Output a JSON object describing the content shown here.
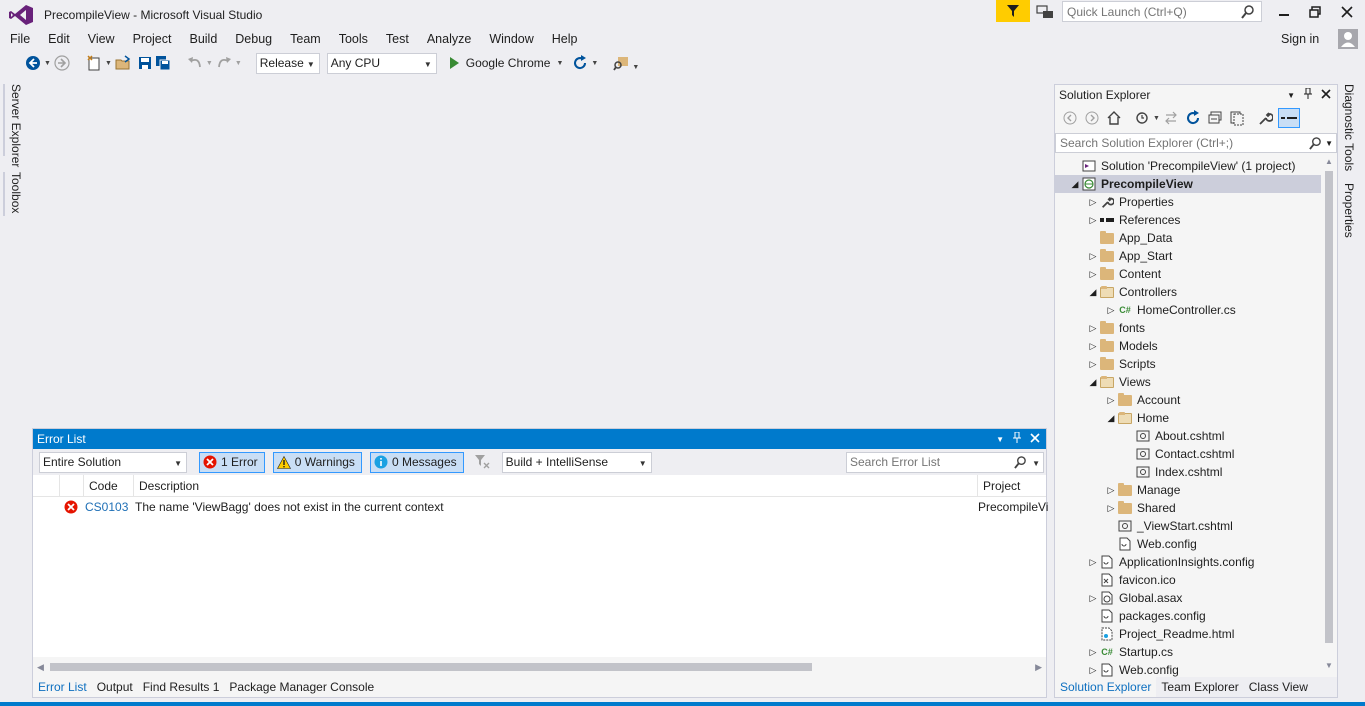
{
  "window": {
    "title": "PrecompileView - Microsoft Visual Studio",
    "quick_launch_placeholder": "Quick Launch (Ctrl+Q)",
    "sign_in": "Sign in"
  },
  "menu": [
    "File",
    "Edit",
    "View",
    "Project",
    "Build",
    "Debug",
    "Team",
    "Tools",
    "Test",
    "Analyze",
    "Window",
    "Help"
  ],
  "toolbar": {
    "configuration": "Release",
    "platform": "Any CPU",
    "run_target": "Google Chrome"
  },
  "left_tabs": [
    "Server Explorer",
    "Toolbox"
  ],
  "right_tabs": [
    "Diagnostic Tools",
    "Properties"
  ],
  "error_list": {
    "title": "Error List",
    "scope": "Entire Solution",
    "errors_label": "1 Error",
    "warnings_label": "0 Warnings",
    "messages_label": "0 Messages",
    "build_filter": "Build + IntelliSense",
    "search_placeholder": "Search Error List",
    "columns": {
      "code": "Code",
      "description": "Description",
      "project": "Project"
    },
    "rows": [
      {
        "code": "CS0103",
        "description": "The name 'ViewBagg' does not exist in the current context",
        "project": "PrecompileVi"
      }
    ]
  },
  "bottom_tabs": [
    "Error List",
    "Output",
    "Find Results 1",
    "Package Manager Console"
  ],
  "solution_explorer": {
    "title": "Solution Explorer",
    "search_placeholder": "Search Solution Explorer (Ctrl+;)",
    "tree": [
      {
        "label": "Solution 'PrecompileView' (1 project)",
        "level": 0,
        "expander": "",
        "icon": "solution-icon"
      },
      {
        "label": "PrecompileView",
        "level": 0,
        "expander": "open",
        "icon": "web-project-icon",
        "selected": true
      },
      {
        "label": "Properties",
        "level": 1,
        "expander": "closed",
        "icon": "wrench-icon"
      },
      {
        "label": "References",
        "level": 1,
        "expander": "closed",
        "icon": "references-icon"
      },
      {
        "label": "App_Data",
        "level": 1,
        "expander": "",
        "icon": "folder-icon"
      },
      {
        "label": "App_Start",
        "level": 1,
        "expander": "closed",
        "icon": "folder-icon"
      },
      {
        "label": "Content",
        "level": 1,
        "expander": "closed",
        "icon": "folder-icon"
      },
      {
        "label": "Controllers",
        "level": 1,
        "expander": "open",
        "icon": "folder-open-icon"
      },
      {
        "label": "HomeController.cs",
        "level": 2,
        "expander": "closed",
        "icon": "csharp-file-icon"
      },
      {
        "label": "fonts",
        "level": 1,
        "expander": "closed",
        "icon": "folder-icon"
      },
      {
        "label": "Models",
        "level": 1,
        "expander": "closed",
        "icon": "folder-icon"
      },
      {
        "label": "Scripts",
        "level": 1,
        "expander": "closed",
        "icon": "folder-icon"
      },
      {
        "label": "Views",
        "level": 1,
        "expander": "open",
        "icon": "folder-open-icon"
      },
      {
        "label": "Account",
        "level": 2,
        "expander": "closed",
        "icon": "folder-icon"
      },
      {
        "label": "Home",
        "level": 2,
        "expander": "open",
        "icon": "folder-open-icon"
      },
      {
        "label": "About.cshtml",
        "level": 3,
        "expander": "",
        "icon": "razor-file-icon"
      },
      {
        "label": "Contact.cshtml",
        "level": 3,
        "expander": "",
        "icon": "razor-file-icon"
      },
      {
        "label": "Index.cshtml",
        "level": 3,
        "expander": "",
        "icon": "razor-file-icon"
      },
      {
        "label": "Manage",
        "level": 2,
        "expander": "closed",
        "icon": "folder-icon"
      },
      {
        "label": "Shared",
        "level": 2,
        "expander": "closed",
        "icon": "folder-icon"
      },
      {
        "label": "_ViewStart.cshtml",
        "level": 2,
        "expander": "",
        "icon": "razor-file-icon"
      },
      {
        "label": "Web.config",
        "level": 2,
        "expander": "",
        "icon": "config-file-icon"
      },
      {
        "label": "ApplicationInsights.config",
        "level": 1,
        "expander": "closed",
        "icon": "config-file-icon"
      },
      {
        "label": "favicon.ico",
        "level": 1,
        "expander": "",
        "icon": "ico-file-icon"
      },
      {
        "label": "Global.asax",
        "level": 1,
        "expander": "closed",
        "icon": "asax-file-icon"
      },
      {
        "label": "packages.config",
        "level": 1,
        "expander": "",
        "icon": "config-file-icon"
      },
      {
        "label": "Project_Readme.html",
        "level": 1,
        "expander": "",
        "icon": "html-file-icon"
      },
      {
        "label": "Startup.cs",
        "level": 1,
        "expander": "closed",
        "icon": "csharp-file-icon"
      },
      {
        "label": "Web.config",
        "level": 1,
        "expander": "closed",
        "icon": "config-file-icon"
      }
    ]
  },
  "solution_explorer_tabs": [
    "Solution Explorer",
    "Team Explorer",
    "Class View"
  ],
  "colors": {
    "accent": "#007acc",
    "error": "#e51400",
    "vs_purple": "#68217a",
    "notification": "#ffcc00"
  }
}
